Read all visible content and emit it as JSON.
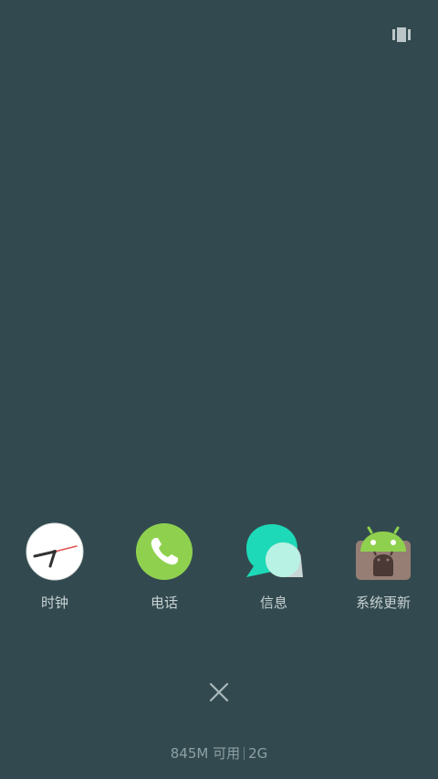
{
  "top": {
    "icon": "recents-grid-icon"
  },
  "apps": [
    {
      "label": "时钟",
      "icon": "clock-icon"
    },
    {
      "label": "电话",
      "icon": "phone-icon"
    },
    {
      "label": "信息",
      "icon": "messages-icon"
    },
    {
      "label": "系统更新",
      "icon": "system-update-icon"
    }
  ],
  "close": {
    "icon": "close-icon"
  },
  "memory": {
    "available": "845M 可用",
    "total": "2G"
  },
  "colors": {
    "background": "#324a4f",
    "label": "#c8d2d4",
    "memory_text": "#8ea0a4"
  }
}
